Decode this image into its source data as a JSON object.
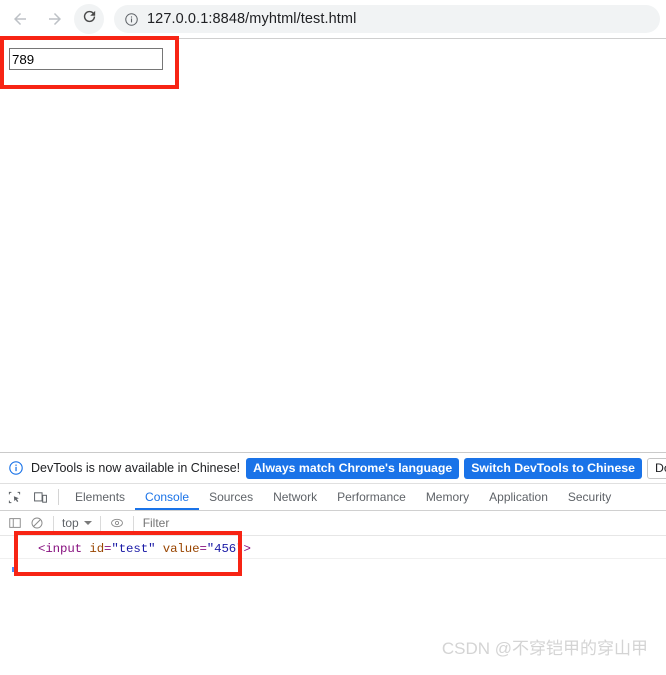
{
  "browser": {
    "nav": {
      "back_icon": "arrow-left-icon",
      "forward_icon": "arrow-right-icon",
      "reload_icon": "reload-icon"
    },
    "omnibox": {
      "info_icon": "info-circle-icon",
      "url": "127.0.0.1:8848/myhtml/test.html"
    }
  },
  "page": {
    "input_value": "789",
    "input_placeholder": ""
  },
  "devtools": {
    "notification": {
      "info_icon": "info-circle-icon",
      "message": "DevTools is now available in Chinese!",
      "buttons": [
        {
          "label": "Always match Chrome's language",
          "style": "primary"
        },
        {
          "label": "Switch DevTools to Chinese",
          "style": "primary"
        },
        {
          "label": "Don't show again",
          "style": "plain"
        }
      ]
    },
    "toolbar_icons": [
      {
        "name": "inspect-element-icon"
      },
      {
        "name": "device-toolbar-icon"
      }
    ],
    "tabs": [
      {
        "label": "Elements",
        "active": false
      },
      {
        "label": "Console",
        "active": true
      },
      {
        "label": "Sources",
        "active": false
      },
      {
        "label": "Network",
        "active": false
      },
      {
        "label": "Performance",
        "active": false
      },
      {
        "label": "Memory",
        "active": false
      },
      {
        "label": "Application",
        "active": false
      },
      {
        "label": "Security",
        "active": false
      }
    ],
    "console_toolbar": {
      "sidebar_icon": "console-sidebar-icon",
      "clear_icon": "clear-console-icon",
      "context_label": "top",
      "eye_icon": "live-expression-icon",
      "filter_placeholder": "Filter"
    },
    "console_output": [
      {
        "type": "html-element",
        "text": "<input id=\"test\" value=\"456\">",
        "tokens": [
          {
            "t": "<",
            "k": "punct"
          },
          {
            "t": "input",
            "k": "tag"
          },
          {
            "t": " ",
            "k": "plain"
          },
          {
            "t": "id",
            "k": "attr"
          },
          {
            "t": "=",
            "k": "punct"
          },
          {
            "t": "\"test\"",
            "k": "val"
          },
          {
            "t": " ",
            "k": "plain"
          },
          {
            "t": "value",
            "k": "attr"
          },
          {
            "t": "=",
            "k": "punct"
          },
          {
            "t": "\"456\"",
            "k": "val"
          },
          {
            "t": ">",
            "k": "punct"
          }
        ]
      }
    ]
  },
  "annotations": {
    "color": "#f72414",
    "boxes": [
      {
        "name": "highlight-input-field"
      },
      {
        "name": "highlight-console-output"
      }
    ]
  },
  "watermark": {
    "text": "CSDN @不穿铠甲的穿山甲"
  }
}
